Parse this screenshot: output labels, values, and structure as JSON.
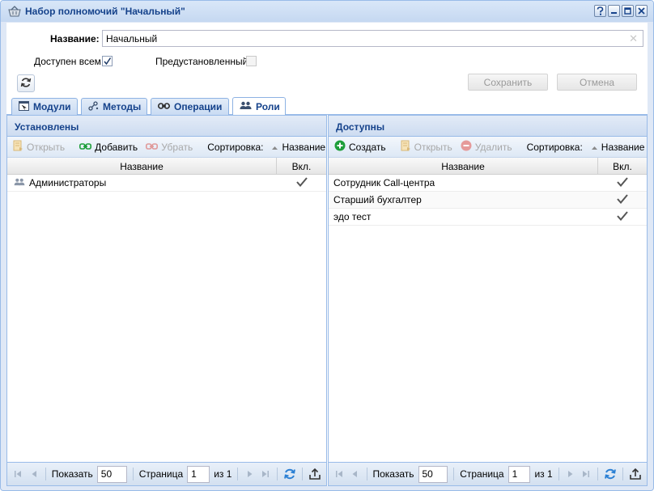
{
  "window": {
    "title": "Набор полномочий \"Начальный\"",
    "tools": [
      "help-icon",
      "minimize-icon",
      "maximize-icon",
      "close-icon"
    ]
  },
  "form": {
    "name_label": "Название:",
    "name_value": "Начальный",
    "public_label": "Доступен всем:",
    "public_checked": true,
    "preset_label": "Предустановленный:",
    "preset_checked": false,
    "save_label": "Сохранить",
    "cancel_label": "Отмена"
  },
  "tabs": [
    {
      "label": "Модули",
      "icon": "module-icon",
      "active": false
    },
    {
      "label": "Методы",
      "icon": "methods-icon",
      "active": false
    },
    {
      "label": "Операции",
      "icon": "link-icon",
      "active": false
    },
    {
      "label": "Роли",
      "icon": "users-icon",
      "active": true
    }
  ],
  "installed": {
    "title": "Установлены",
    "toolbar": {
      "open": "Открыть",
      "add": "Добавить",
      "remove": "Убрать",
      "sort_label": "Сортировка:",
      "sort_field": "Название"
    },
    "columns": {
      "name": "Название",
      "enabled": "Вкл."
    },
    "rows": [
      {
        "name": "Администраторы",
        "enabled": true
      }
    ],
    "pager": {
      "show_label": "Показать",
      "show_value": "50",
      "page_label": "Страница",
      "page_value": "1",
      "of_label": "из 1"
    }
  },
  "available": {
    "title": "Доступны",
    "toolbar": {
      "create": "Создать",
      "open": "Открыть",
      "delete": "Удалить",
      "sort_label": "Сортировка:",
      "sort_field": "Название"
    },
    "columns": {
      "name": "Название",
      "enabled": "Вкл."
    },
    "rows": [
      {
        "name": "Сотрудник Call-центра",
        "enabled": true
      },
      {
        "name": "Старший бухгалтер",
        "enabled": true
      },
      {
        "name": "эдо тест",
        "enabled": true
      }
    ],
    "pager": {
      "show_label": "Показать",
      "show_value": "50",
      "page_label": "Страница",
      "page_value": "1",
      "of_label": "из 1"
    }
  },
  "colors": {
    "accent": "#15428b",
    "border": "#99bbe8",
    "create_green": "#1e9e3a",
    "delete_red": "#e07070"
  }
}
